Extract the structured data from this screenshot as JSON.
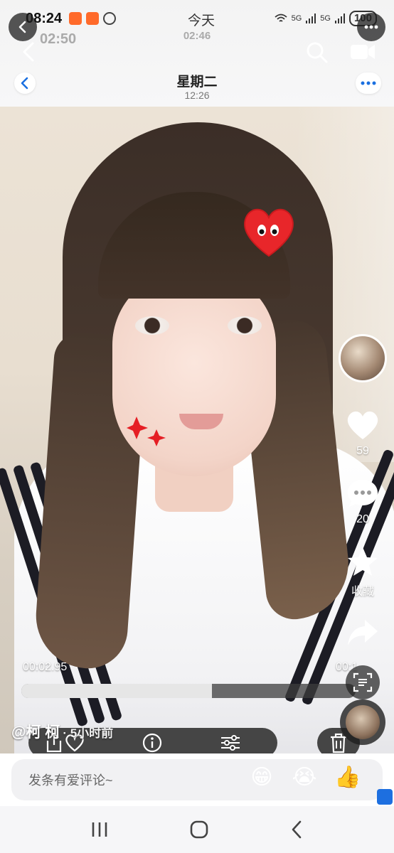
{
  "status_bar": {
    "time": "08:24",
    "center_label": "今天",
    "network_1": "5G",
    "network_2": "5G",
    "battery": "100"
  },
  "ghost_overlay": {
    "time": "02:50",
    "center_time": "02:46"
  },
  "chat_header": {
    "title": "星期二",
    "subtitle": "12:26"
  },
  "video": {
    "current_time": "00:02.95",
    "end_time_partial": "00:1",
    "progress_fraction": 0.57
  },
  "rail": {
    "like_count": "59",
    "comment_count": "20",
    "favorite_label": "收藏"
  },
  "post": {
    "author": "@柯 柯",
    "ago": "· 5小时前"
  },
  "comment_bar": {
    "placeholder": "发条有爱评论~",
    "emoji_1": "😁",
    "emoji_2": "😭",
    "emoji_3": "👍"
  },
  "icons": {
    "back": "chevron-left-icon",
    "search": "search-icon",
    "camera": "video-camera-icon",
    "more": "more-icon",
    "like": "heart-icon",
    "comment": "comment-icon",
    "favorite": "star-icon",
    "share": "share-icon",
    "ocr": "scan-text-icon",
    "trash": "trash-icon",
    "info": "info-icon",
    "adjust": "sliders-icon"
  }
}
